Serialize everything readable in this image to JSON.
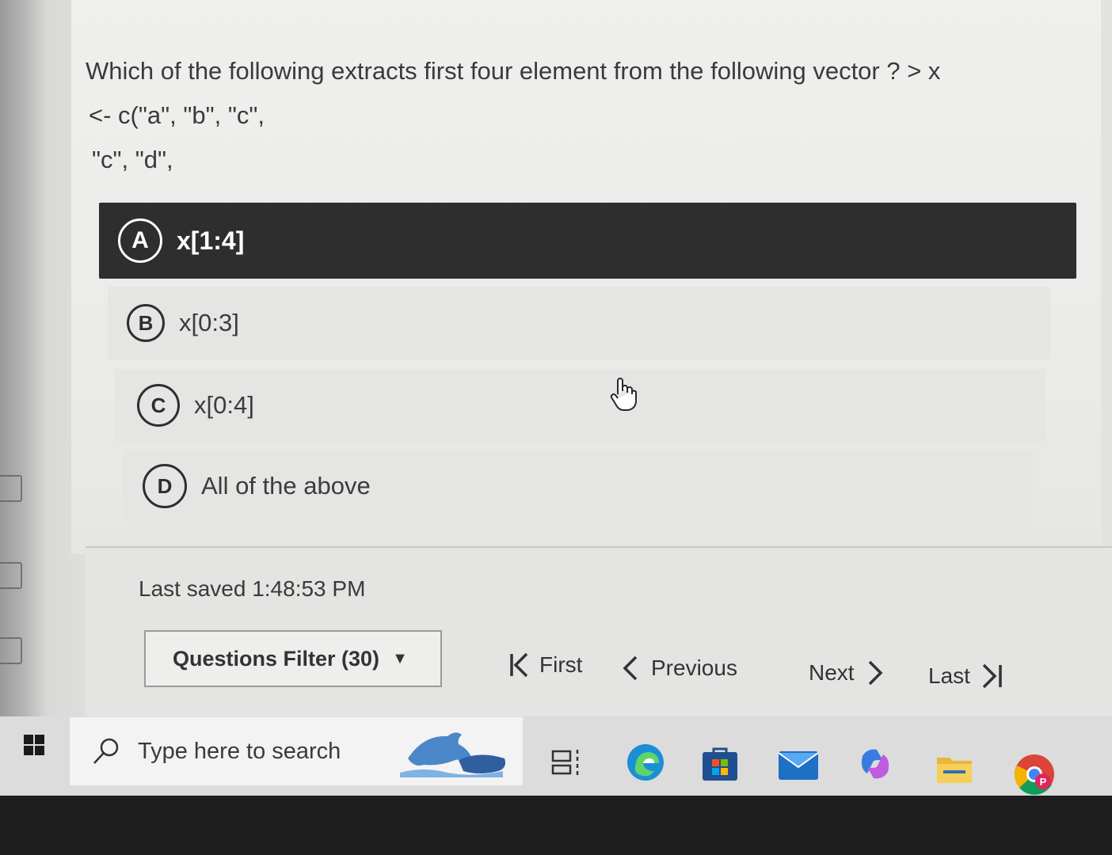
{
  "question": {
    "lines": [
      "Which of the following extracts first four element from the following vector ? > x",
      "<- c(\"a\", \"b\", \"c\",",
      "\"c\", \"d\","
    ]
  },
  "options": [
    {
      "letter": "A",
      "text": "x[1:4]",
      "selected": true
    },
    {
      "letter": "B",
      "text": "x[0:3]",
      "selected": false
    },
    {
      "letter": "C",
      "text": "x[0:4]",
      "selected": false
    },
    {
      "letter": "D",
      "text": "All of the above",
      "selected": false
    }
  ],
  "status": {
    "last_saved": "Last saved 1:48:53 PM"
  },
  "footer": {
    "filter_label": "Questions Filter (30)",
    "first": "First",
    "previous": "Previous",
    "next": "Next",
    "last": "Last"
  },
  "taskbar": {
    "search_placeholder": "Type here to search",
    "icons": [
      "windows-start-icon",
      "search-icon",
      "dolphin-widget-icon",
      "task-view-icon",
      "edge-icon",
      "microsoft-store-icon",
      "mail-icon",
      "copilot-icon",
      "file-explorer-icon",
      "chrome-profile-icon"
    ]
  },
  "colors": {
    "selected_bg": "#2e2e2e",
    "page_bg": "#ebebe9",
    "text": "#3a3a3a"
  }
}
